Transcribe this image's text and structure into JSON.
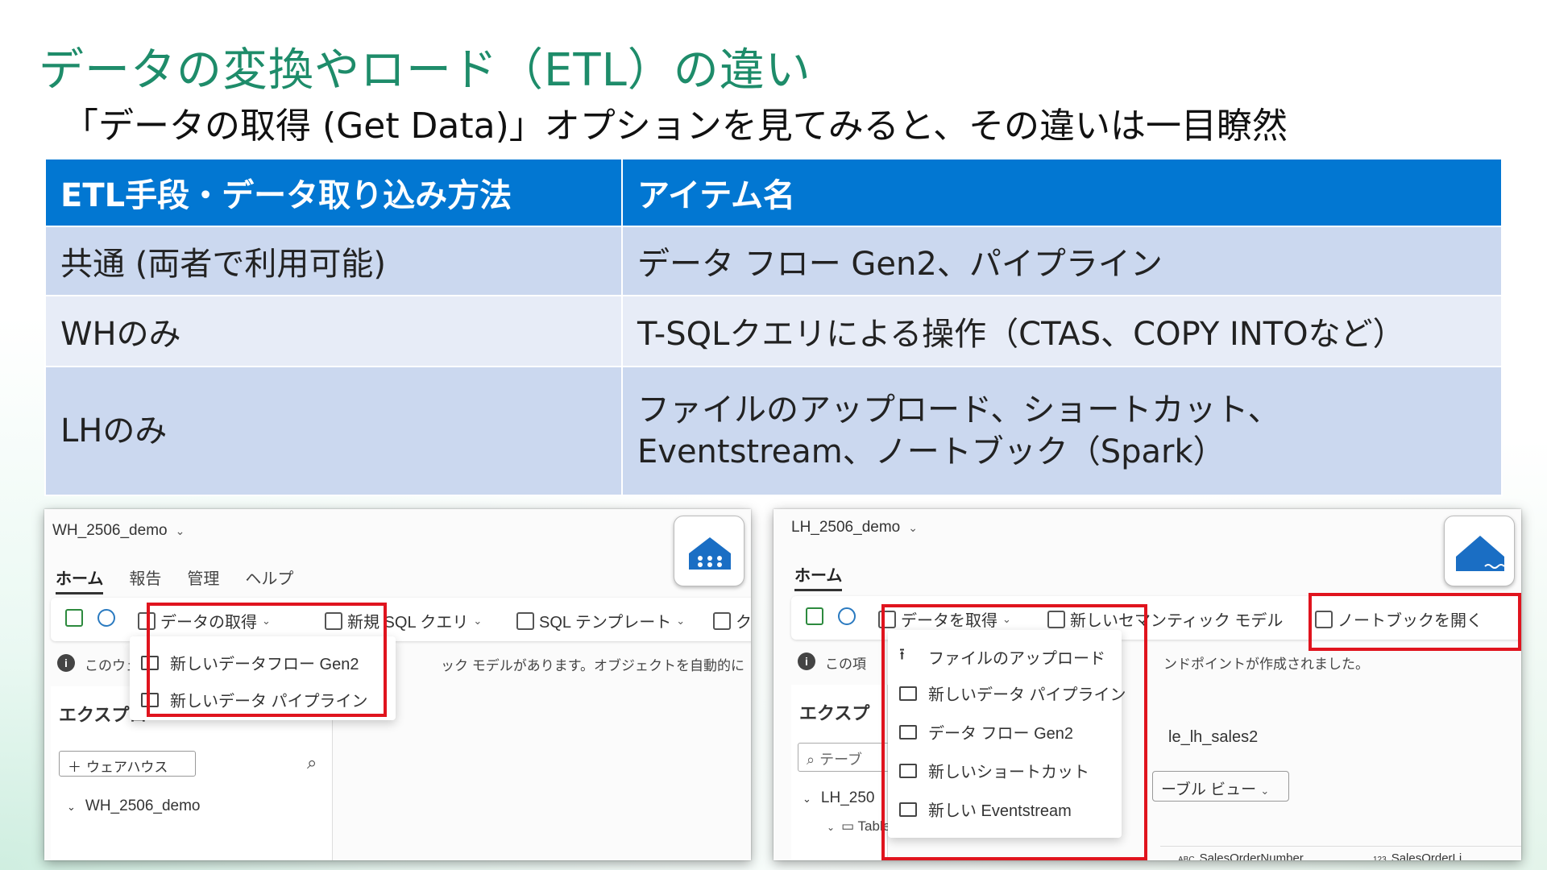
{
  "title": "データの変換やロード（ETL）の違い",
  "subtitle": "「データの取得 (Get Data)」オプションを見てみると、その違いは一目瞭然",
  "table": {
    "headers": [
      "ETL手段・データ取り込み方法",
      "アイテム名"
    ],
    "rows": [
      [
        "共通 (両者で利用可能)",
        "データ フロー Gen2、パイプライン"
      ],
      [
        "WHのみ",
        "T-SQLクエリによる操作（CTAS、COPY INTOなど）"
      ],
      [
        "LHのみ",
        "ファイルのアップロード、ショートカット、",
        "Eventstream、ノートブック（Spark）"
      ]
    ]
  },
  "wh": {
    "workspace": "WH_2506_demo",
    "tabs": [
      "ホーム",
      "報告",
      "管理",
      "ヘルプ"
    ],
    "toolbar": {
      "get_data": "データの取得",
      "new_sql": "新規 SQL クエリ",
      "sql_template": "SQL テンプレート",
      "truncated": "ク"
    },
    "dropdown": [
      "新しいデータフロー Gen2",
      "新しいデータ パイプライン"
    ],
    "info_left": "このウェ",
    "info_right": "ック モデルがあります。オブジェクトを自動的に",
    "explorer_title": "エクスプロ",
    "add_button": "ウェアハウス",
    "tree_item": "WH_2506_demo"
  },
  "lh": {
    "workspace": "LH_2506_demo",
    "tabs": [
      "ホーム"
    ],
    "toolbar": {
      "get_data": "データを取得",
      "semantic": "新しいセマンティック モデル",
      "notebook": "ノートブックを開く"
    },
    "dropdown": [
      "ファイルのアップロード",
      "新しいデータ パイプライン",
      "データ フロー Gen2",
      "新しいショートカット",
      "新しい Eventstream"
    ],
    "info_left": "この項",
    "info_right": "ンドポイントが作成されました。",
    "explorer_title": "エクスプ",
    "search_placeholder": "テーブ",
    "tree_item": "LH_250",
    "tables_node": "Tables",
    "table_name": "le_lh_sales2",
    "view_button": "ーブル ビュー",
    "col1": "SalesOrderNumber",
    "col2": "SalesOrderLi",
    "col1_type": "ABC",
    "col2_type": "123"
  },
  "colors": {
    "accent": "#0277d2",
    "title": "#1e8c6a",
    "highlight": "#e0141e"
  }
}
